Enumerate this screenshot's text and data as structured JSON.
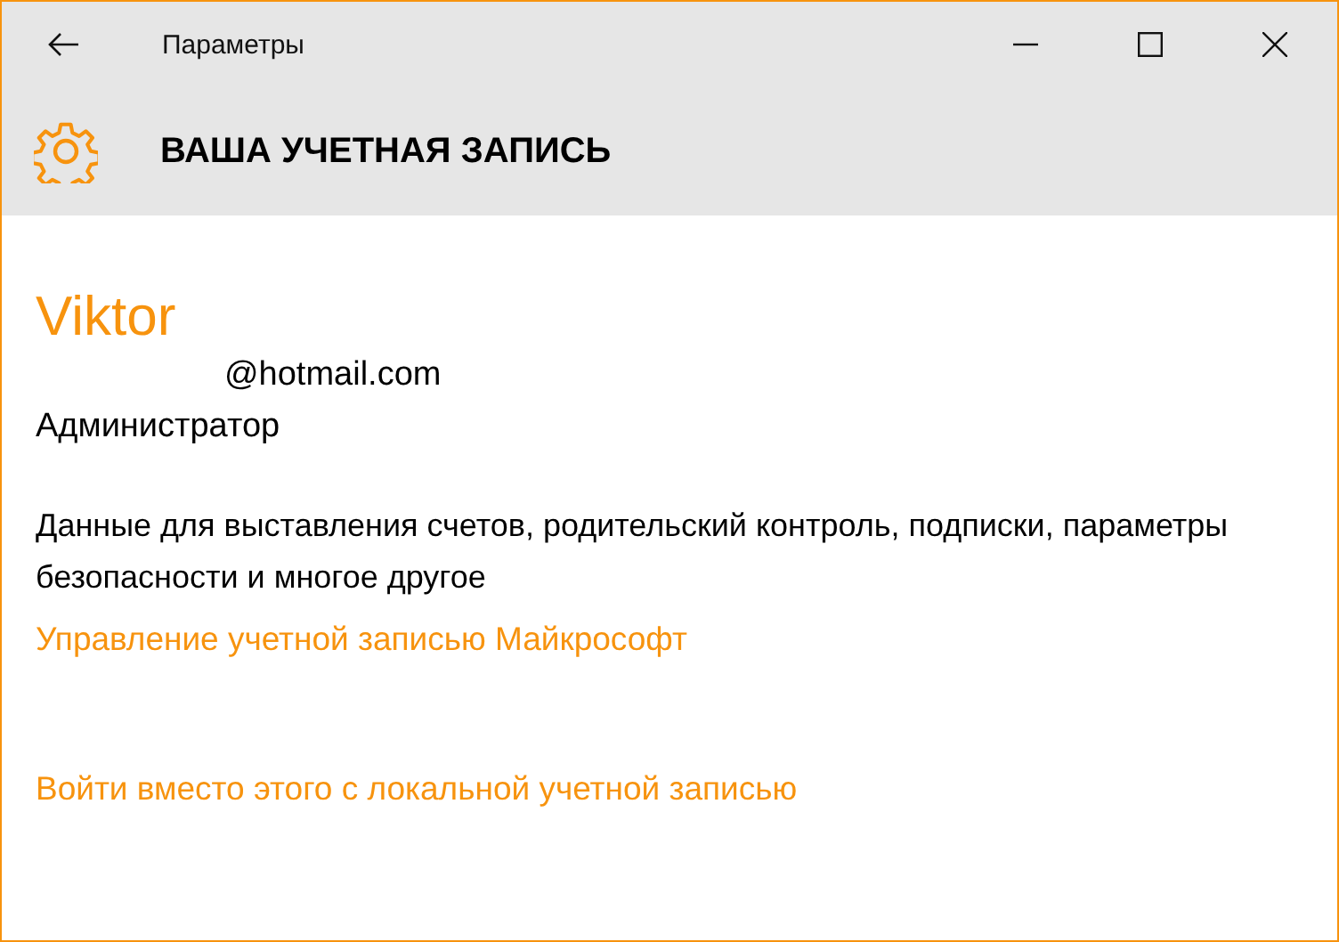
{
  "window": {
    "title": "Параметры"
  },
  "header": {
    "title": "ВАША УЧЕТНАЯ ЗАПИСЬ"
  },
  "account": {
    "name": "Viktor",
    "email": "@hotmail.com",
    "role": "Администратор"
  },
  "description": "Данные для выставления счетов, родительский контроль, подписки, параметры безопасности и многое другое",
  "links": [
    "Управление учетной записью Майкрософт",
    "Войти вместо этого с локальной учетной записью"
  ]
}
